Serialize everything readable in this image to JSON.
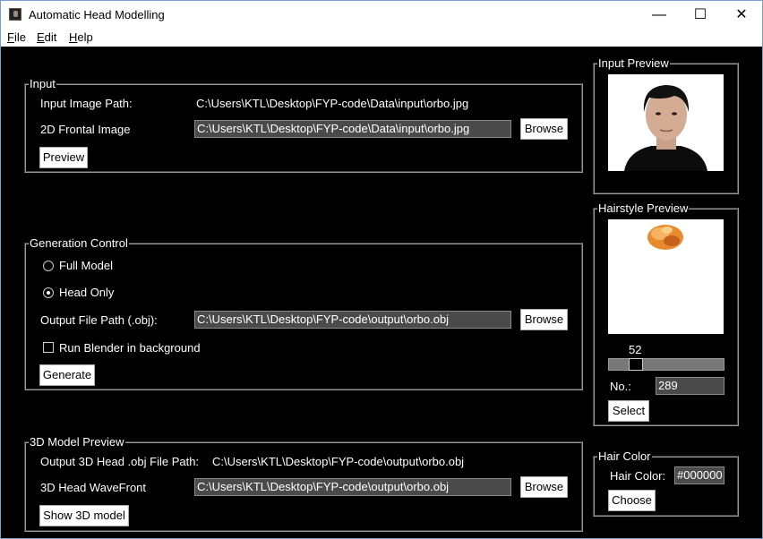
{
  "window": {
    "title": "Automatic Head Modelling",
    "controls": {
      "minimize": "—",
      "maximize": "☐",
      "close": "✕"
    }
  },
  "menu": {
    "file": {
      "accel": "F",
      "rest": "ile"
    },
    "edit": {
      "accel": "E",
      "rest": "dit"
    },
    "help": {
      "accel": "H",
      "rest": "elp"
    }
  },
  "input": {
    "legend": "Input",
    "image_path_label": "Input Image Path:",
    "image_path_value": "C:\\Users\\KTL\\Desktop\\FYP-code\\Data\\input\\orbo.jpg",
    "frontal_label": "2D Frontal Image",
    "frontal_value": "C:\\Users\\KTL\\Desktop\\FYP-code\\Data\\input\\orbo.jpg",
    "browse_label": "Browse",
    "preview_label": "Preview"
  },
  "generation": {
    "legend": "Generation Control",
    "full_model_label": "Full Model",
    "head_only_label": "Head Only",
    "selected_mode": "Head Only",
    "output_label": "Output File Path (.obj):",
    "output_value": "C:\\Users\\KTL\\Desktop\\FYP-code\\output\\orbo.obj",
    "browse_label": "Browse",
    "blender_label": "Run Blender in  background",
    "blender_checked": false,
    "generate_label": "Generate"
  },
  "preview3d": {
    "legend": "3D Model Preview",
    "obj_path_label": "Output 3D Head .obj File Path:",
    "obj_path_value": "C:\\Users\\KTL\\Desktop\\FYP-code\\output\\orbo.obj",
    "wavefront_label": "3D Head WaveFront",
    "wavefront_value": "C:\\Users\\KTL\\Desktop\\FYP-code\\output\\orbo.obj",
    "browse_label": "Browse",
    "show_label": "Show 3D model"
  },
  "input_preview": {
    "legend": "Input Preview"
  },
  "hairstyle": {
    "legend": "Hairstyle Preview",
    "slider_value": "52",
    "slider_fraction": 0.2,
    "no_label": "No.:",
    "no_value": "289",
    "select_label": "Select"
  },
  "hair_color": {
    "legend": "Hair Color",
    "label": "Hair Color:",
    "value": "#000000",
    "choose_label": "Choose"
  },
  "colors": {
    "background": "#000000",
    "field_bg": "#4a4a4a",
    "titlebar": "#ffffff"
  }
}
